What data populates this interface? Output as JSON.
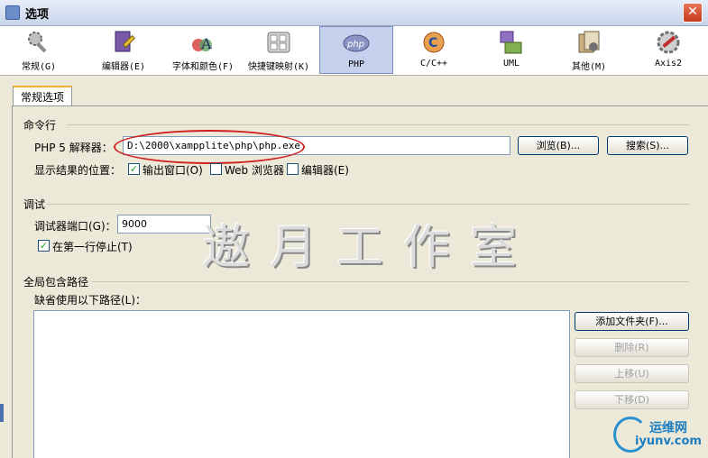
{
  "window": {
    "title": "选项",
    "close": "✕"
  },
  "categories": [
    {
      "label": "常规(G)",
      "icon": "wrench-gear-icon",
      "color": "#8c8c8c"
    },
    {
      "label": "编辑器(E)",
      "icon": "book-pencil-icon",
      "color": "#8a6ac0"
    },
    {
      "label": "字体和颜色(F)",
      "icon": "font-color-icon",
      "color": "#d04040"
    },
    {
      "label": "快捷键映射(K)",
      "icon": "keyboard-icon",
      "color": "#909090"
    },
    {
      "label": "PHP",
      "icon": "php-icon",
      "color": "#7a86b8"
    },
    {
      "label": "C/C++",
      "icon": "cpp-icon",
      "color": "#e08030"
    },
    {
      "label": "UML",
      "icon": "uml-icon",
      "color": "#70a040"
    },
    {
      "label": "其他(M)",
      "icon": "misc-icon",
      "color": "#a08850"
    },
    {
      "label": "Axis2",
      "icon": "axis2-gear-icon",
      "color": "#c03030"
    }
  ],
  "tab": {
    "label": "常规选项"
  },
  "command_line": {
    "section_title": "命令行",
    "interpreter_label": "PHP 5 解释器：",
    "interpreter_value": "D:\\2000\\xampplite\\php\\php.exe",
    "browse_button": "浏览(B)...",
    "search_button": "搜索(S)...",
    "output_label": "显示结果的位置：",
    "options": [
      {
        "label": "输出窗口(O)",
        "checked": true
      },
      {
        "label": "Web 浏览器",
        "checked": false
      },
      {
        "label": "编辑器(E)",
        "checked": false
      }
    ]
  },
  "debug": {
    "section_title": "调试",
    "port_label": "调试器端口(G)：",
    "port_value": "9000",
    "stop_first_line": {
      "label": "在第一行停止(T)",
      "checked": true
    }
  },
  "include_path": {
    "section_title": "全局包含路径",
    "list_label": "缺省使用以下路径(L)：",
    "add_folder_button": "添加文件夹(F)...",
    "remove_button": "删除(R)",
    "move_up_button": "上移(U)",
    "move_down_button": "下移(D)"
  },
  "watermark": "遨月工作室",
  "site_logo": {
    "cn": "运维网",
    "en": "iyunv.com"
  }
}
